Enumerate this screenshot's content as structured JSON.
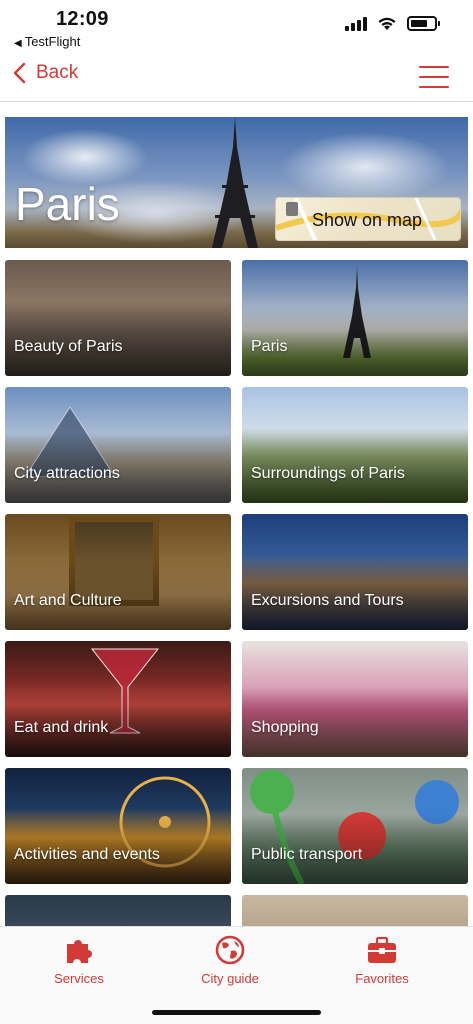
{
  "status_bar": {
    "time": "12:09",
    "back_app": "TestFlight",
    "icons": [
      "cellular-signal-icon",
      "wifi-icon",
      "battery-icon"
    ]
  },
  "navbar": {
    "back_label": "Back",
    "back_icon": "chevron-left-icon",
    "menu_icon": "hamburger-menu-icon",
    "accent_color": "#d23a36"
  },
  "hero": {
    "title": "Paris",
    "map_button_label": "Show on map"
  },
  "tiles": [
    {
      "label": "Beauty of Paris"
    },
    {
      "label": "Paris"
    },
    {
      "label": "City attractions"
    },
    {
      "label": "Surroundings of Paris"
    },
    {
      "label": "Art and Culture"
    },
    {
      "label": "Excursions and Tours"
    },
    {
      "label": "Eat and drink"
    },
    {
      "label": "Shopping"
    },
    {
      "label": "Activities and events"
    },
    {
      "label": "Public transport"
    }
  ],
  "tabbar": {
    "items": [
      {
        "label": "Services",
        "icon": "puzzle-icon"
      },
      {
        "label": "City guide",
        "icon": "globe-icon"
      },
      {
        "label": "Favorites",
        "icon": "briefcase-icon"
      }
    ]
  }
}
